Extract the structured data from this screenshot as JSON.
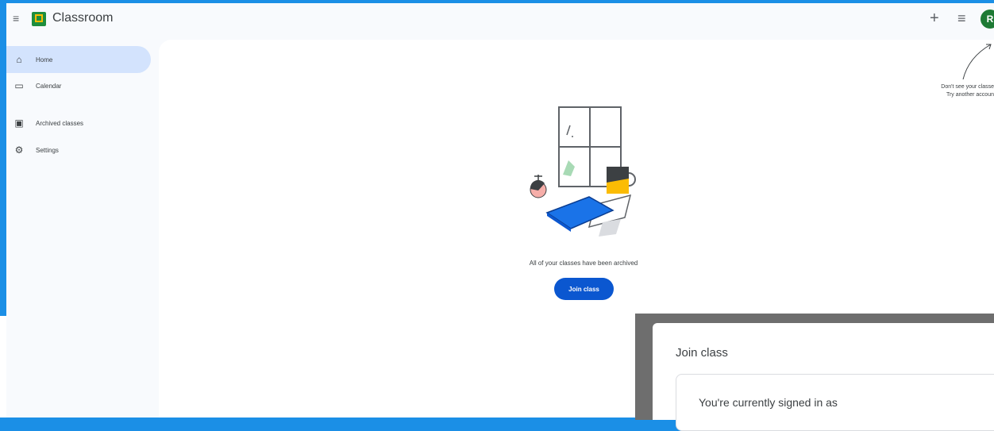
{
  "app": {
    "title": "Classroom"
  },
  "topbar": {
    "menu_icon": "menu-icon",
    "add_icon": "plus-icon",
    "apps_icon": "apps-icon",
    "avatar_letter": "R"
  },
  "sidebar": {
    "items": [
      {
        "label": "Home",
        "icon": "home-icon",
        "active": true
      },
      {
        "label": "Calendar",
        "icon": "calendar-icon"
      },
      {
        "label": "Archived classes",
        "icon": "archive-icon"
      },
      {
        "label": "Settings",
        "icon": "gear-icon"
      }
    ]
  },
  "main": {
    "empty_message": "All of your classes have been archived",
    "join_button": "Join class",
    "hint_line1": "Don't see your classe",
    "hint_line2": "Try another accoun"
  },
  "dialog": {
    "title": "Join class",
    "signed_in_text": "You're currently signed in as"
  },
  "colors": {
    "accent": "#0b57d0",
    "active_nav": "#d3e3fd",
    "frame": "#1b8fe6"
  }
}
